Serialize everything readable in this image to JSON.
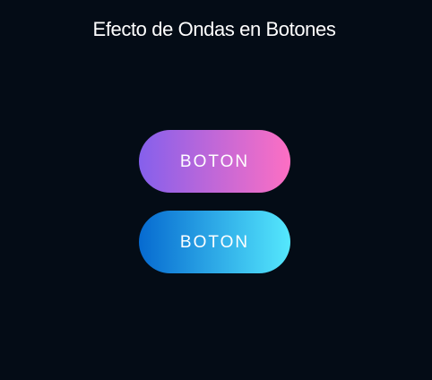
{
  "page": {
    "title": "Efecto de Ondas en Botones",
    "background": "#040c16"
  },
  "buttons": [
    {
      "label": "BOTON",
      "gradient_start": "#8560ec",
      "gradient_end": "#fd6fc3"
    },
    {
      "label": "BOTON",
      "gradient_start": "#066ad0",
      "gradient_end": "#55e8fd"
    }
  ]
}
